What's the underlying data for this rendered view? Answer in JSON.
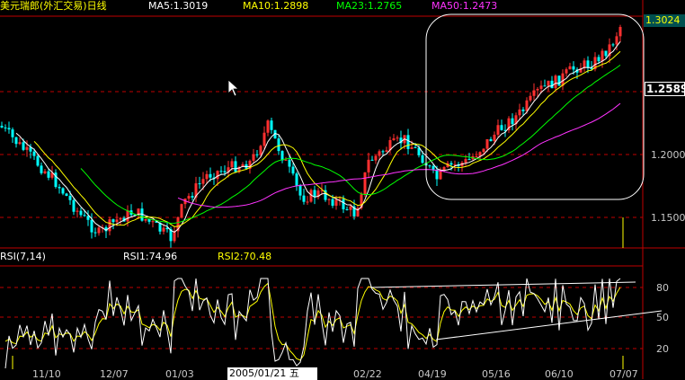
{
  "header": {
    "title": "美元瑞郎(外汇交易)日线",
    "ma": [
      {
        "label": "MA5:1.3019",
        "color": "#ffffff"
      },
      {
        "label": "MA10:1.2898",
        "color": "#ffff00"
      },
      {
        "label": "MA23:1.2765",
        "color": "#00ff00"
      },
      {
        "label": "MA50:1.2473",
        "color": "#ff33ff"
      }
    ]
  },
  "price_axis": {
    "current": "1.3024",
    "highlight": "1.2589",
    "ticks": [
      "1.2000",
      "1.1500"
    ]
  },
  "rsi_panel": {
    "title": "RSI(7,14)",
    "rsi1": "RSI1:74.96",
    "rsi2": "RSI2:70.48",
    "ticks": [
      "80",
      "50",
      "20"
    ]
  },
  "x_axis": {
    "labels": [
      "11/10",
      "12/07",
      "01/03",
      "02/22",
      "04/19",
      "05/16",
      "06/10",
      "07/07"
    ],
    "cursor_date": "2005/01/21 五"
  },
  "colors": {
    "background": "#000000",
    "up_candle": "#ff3030",
    "down_candle": "#00ffff",
    "grid": "#c00000",
    "title": "#ffff00",
    "ma5": "#ffffff",
    "ma10": "#ffff00",
    "ma23": "#00ff00",
    "ma50": "#ff33ff",
    "rsi1": "#ffffff",
    "rsi2": "#ffff00"
  }
}
